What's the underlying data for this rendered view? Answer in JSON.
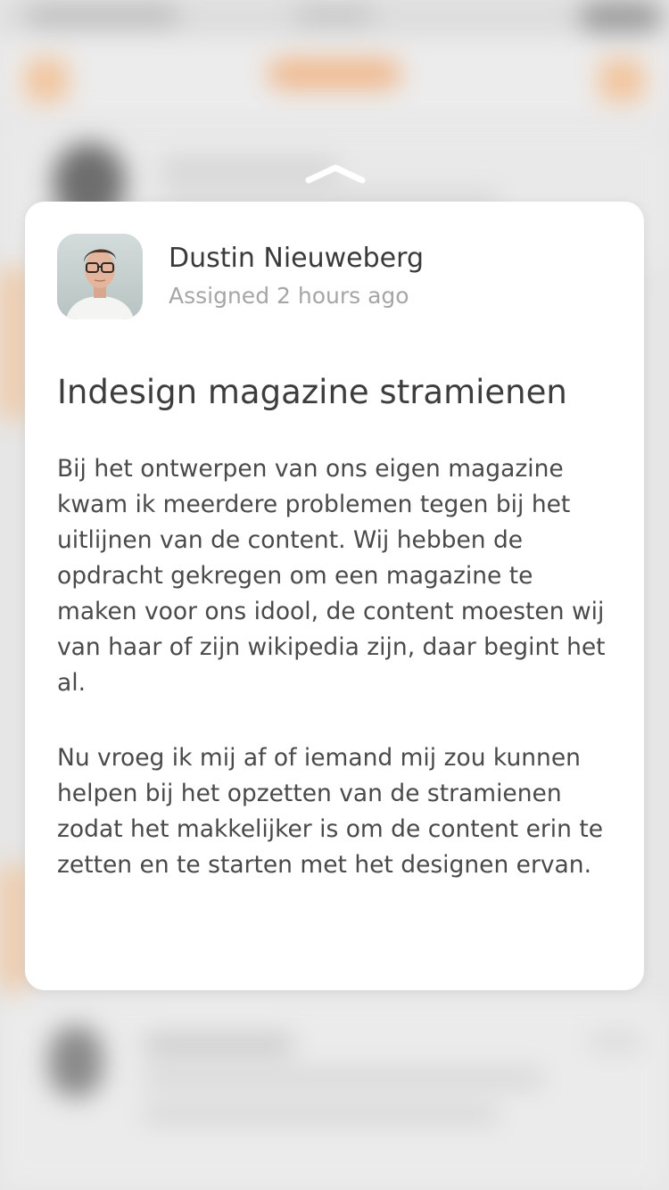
{
  "preview_card": {
    "author": {
      "name": "Dustin Nieuweberg",
      "assigned_text": "Assigned 2 hours ago"
    },
    "title": "Indesign magazine stramienen",
    "paragraphs": [
      "Bij het ontwerpen van ons eigen magazine kwam ik meerdere problemen tegen bij het uitlijnen van de content. Wij hebben de opdracht gekregen om een magazine te maken voor ons idool, de content moesten wij van haar of zijn wikipedia zijn, daar begint het al.",
      "Nu vroeg ik mij af of iemand mij zou kunnen helpen bij het opzetten van de stramienen zodat het makkelijker is om de content erin te zetten en te starten met het designen ervan."
    ]
  },
  "colors": {
    "background": "#e6e6e6",
    "card": "#ffffff",
    "accent_blurred": "#f0b88c",
    "text_primary": "#3a3a3a",
    "text_secondary": "#a6a6a6"
  },
  "icons": {
    "swipe_indicator": "chevron-up-icon",
    "author_avatar": "user-avatar"
  }
}
